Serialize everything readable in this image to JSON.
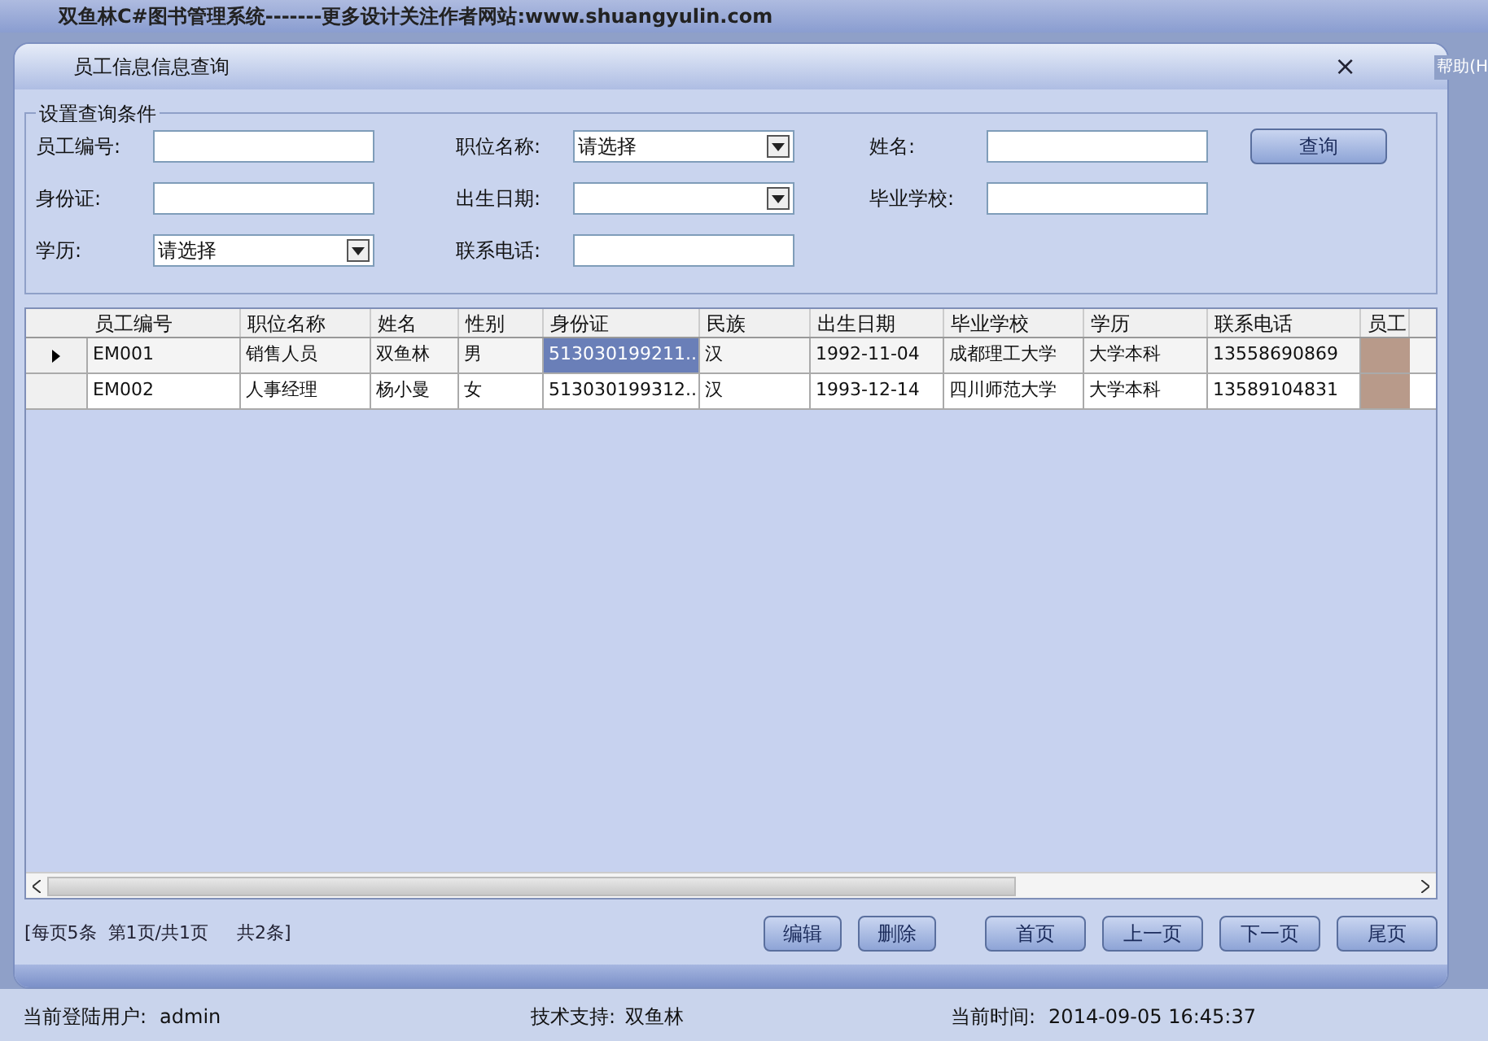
{
  "app_window": {
    "title": "双鱼林C#图书管理系统-------更多设计关注作者网站:www.shuangyulin.com",
    "menu_fragment": "帮助(H"
  },
  "window": {
    "title": "员工信息信息查询",
    "close": "×"
  },
  "query_group": {
    "title": "设置查询条件",
    "fields": [
      {
        "kind": "text",
        "label": "员工编号:"
      },
      {
        "kind": "select",
        "label": "职位名称:",
        "value": "请选择"
      },
      {
        "kind": "text",
        "label": "姓名:"
      },
      {
        "kind": "text",
        "label": "身份证:"
      },
      {
        "kind": "select",
        "label": "出生日期:"
      },
      {
        "kind": "text",
        "label": "毕业学校:"
      },
      {
        "kind": "select",
        "label": "学历:",
        "value": "请选择"
      },
      {
        "kind": "text",
        "label": "联系电话:"
      }
    ],
    "search_button": "查询"
  },
  "table": {
    "columns": [
      "员工编号",
      "职位名称",
      "姓名",
      "性别",
      "身份证",
      "民族",
      "出生日期",
      "毕业学校",
      "学历",
      "联系电话",
      "员工"
    ],
    "rows": [
      {
        "selected": true,
        "cells": [
          "EM001",
          "销售人员",
          "双鱼林",
          "男",
          "513030199211...",
          "汉",
          "1992-11-04",
          "成都理工大学",
          "大学本科",
          "13558690869"
        ]
      },
      {
        "selected": false,
        "cells": [
          "EM002",
          "人事经理",
          "杨小曼",
          "女",
          "513030199312...",
          "汉",
          "1993-12-14",
          "四川师范大学",
          "大学本科",
          "13589104831"
        ]
      }
    ]
  },
  "pager": {
    "info": "[每页5条  第1页/共1页     共2条]",
    "buttons": [
      "编辑",
      "删除",
      "首页",
      "上一页",
      "下一页",
      "尾页"
    ]
  },
  "status_bar": {
    "user_label": "当前登陆用户:",
    "user": "admin",
    "support_label": "技术支持:",
    "support": "双鱼林",
    "time_label": "当前时间:",
    "time": "2014-09-05 16:45:37"
  }
}
